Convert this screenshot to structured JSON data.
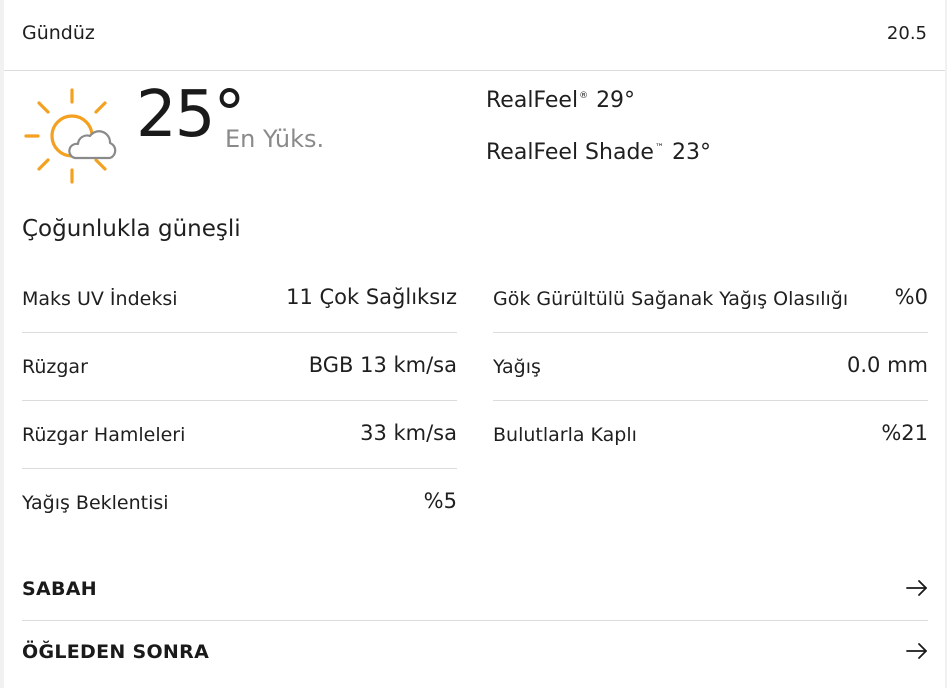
{
  "header": {
    "title": "Gündüz",
    "date": "20.5"
  },
  "current": {
    "icon": "mostly-sunny-icon",
    "temp_value": "25°",
    "temp_label": "En Yüks.",
    "realfeel_label": "RealFeel",
    "realfeel_mark": "®",
    "realfeel_value": "29°",
    "realfeel_shade_label": "RealFeel Shade",
    "realfeel_shade_mark": "™",
    "realfeel_shade_value": "23°"
  },
  "phrase": "Çoğunlukla güneşli",
  "details_left": [
    {
      "label": "Maks UV İndeksi",
      "value": "11 Çok Sağlıksız"
    },
    {
      "label": "Rüzgar",
      "value": "BGB 13 km/sa"
    },
    {
      "label": "Rüzgar Hamleleri",
      "value": "33 km/sa"
    },
    {
      "label": "Yağış Beklentisi",
      "value": "%5"
    }
  ],
  "details_right": [
    {
      "label": "Gök Gürültülü Sağanak Yağış Olasılığı",
      "value": "%0"
    },
    {
      "label": "Yağış",
      "value": "0.0 mm"
    },
    {
      "label": "Bulutlarla Kaplı",
      "value": "%21"
    }
  ],
  "nav": [
    {
      "label": "SABAH",
      "icon": "arrow-right-icon"
    },
    {
      "label": "ÖĞLEDEN SONRA",
      "icon": "arrow-right-icon"
    }
  ],
  "colors": {
    "sun": "#f4a020",
    "cloud_stroke": "#8a8a8a",
    "divider": "#dcdcdc",
    "muted_text": "#8a8a8a"
  }
}
